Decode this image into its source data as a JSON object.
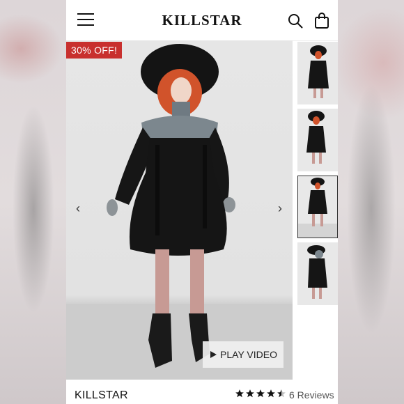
{
  "header": {
    "logo": "KILLSTAR",
    "menu_icon": "hamburger-menu-icon",
    "search_icon": "search-icon",
    "bag_icon": "shopping-bag-icon"
  },
  "gallery": {
    "badge": "30% OFF!",
    "badge_color": "#c8302e",
    "prev_icon": "chevron-left-icon",
    "next_icon": "chevron-right-icon",
    "play_label": "PLAY VIDEO",
    "play_icon": "play-icon",
    "thumbnails_count": 4,
    "active_thumbnail": 3
  },
  "product": {
    "brand": "KILLSTAR",
    "rating": 4.5,
    "rating_max": 5,
    "reviews": "6 Reviews"
  }
}
